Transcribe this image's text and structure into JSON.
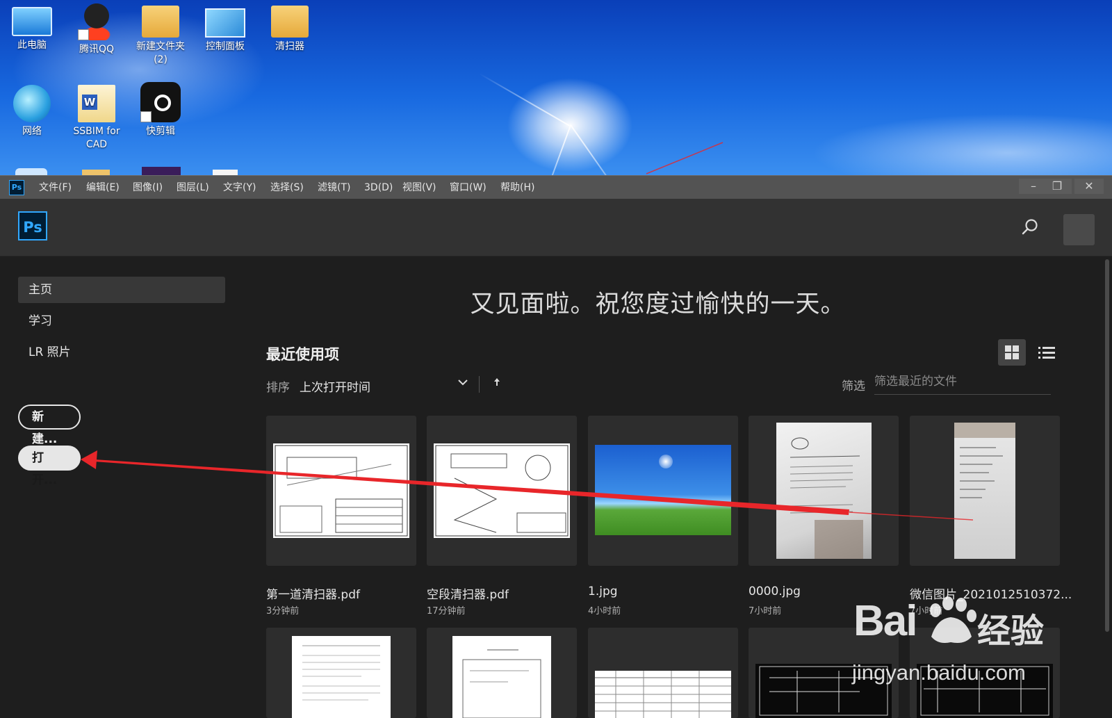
{
  "desktop": {
    "icons": [
      {
        "label": "此电脑",
        "icon": "this-pc-icon"
      },
      {
        "label": "腾讯QQ",
        "icon": "qq-icon"
      },
      {
        "label": "新建文件夹",
        "sub": "(2)",
        "icon": "folder-icon"
      },
      {
        "label": "控制面板",
        "icon": "control-panel-icon"
      },
      {
        "label": "清扫器",
        "icon": "folder-icon"
      },
      {
        "label": "网络",
        "icon": "network-icon"
      },
      {
        "label": "SSBIM for",
        "sub": "CAD",
        "icon": "word-doc-icon"
      },
      {
        "label": "快剪辑",
        "icon": "kuaijianji-icon"
      }
    ]
  },
  "menubar": {
    "app_icon": "Ps",
    "items": [
      "文件(F)",
      "编辑(E)",
      "图像(I)",
      "图层(L)",
      "文字(Y)",
      "选择(S)",
      "滤镜(T)",
      "3D(D)",
      "视图(V)",
      "窗口(W)",
      "帮助(H)"
    ],
    "window_buttons": {
      "minimize": "–",
      "restore": "❐",
      "close": "✕"
    }
  },
  "header": {
    "logo": "Ps",
    "search_icon": "search-icon"
  },
  "sidebar": {
    "items": [
      {
        "label": "主页",
        "active": true
      },
      {
        "label": "学习",
        "active": false
      },
      {
        "label": "LR 照片",
        "active": false
      }
    ],
    "new_button": "新建...",
    "open_button": "打开..."
  },
  "main": {
    "greeting": "又见面啦。祝您度过愉快的一天。",
    "recent_title": "最近使用项",
    "sort_label": "排序",
    "sort_value": "上次打开时间",
    "filter_label": "筛选",
    "filter_placeholder": "筛选最近的文件",
    "files": [
      {
        "name": "第一道清扫器.pdf",
        "time": "3分钟前"
      },
      {
        "name": "空段清扫器.pdf",
        "time": "17分钟前"
      },
      {
        "name": "1.jpg",
        "time": "4小时前"
      },
      {
        "name": "0000.jpg",
        "time": "7小时前"
      },
      {
        "name": "微信图片_2021012510372...",
        "time": "7小时前"
      }
    ]
  },
  "watermark": {
    "brand": "Bai",
    "product": "经验",
    "url": "jingyan.baidu.com"
  },
  "colors": {
    "ps_blue": "#31a8ff",
    "arrow_red": "#e8262a"
  }
}
